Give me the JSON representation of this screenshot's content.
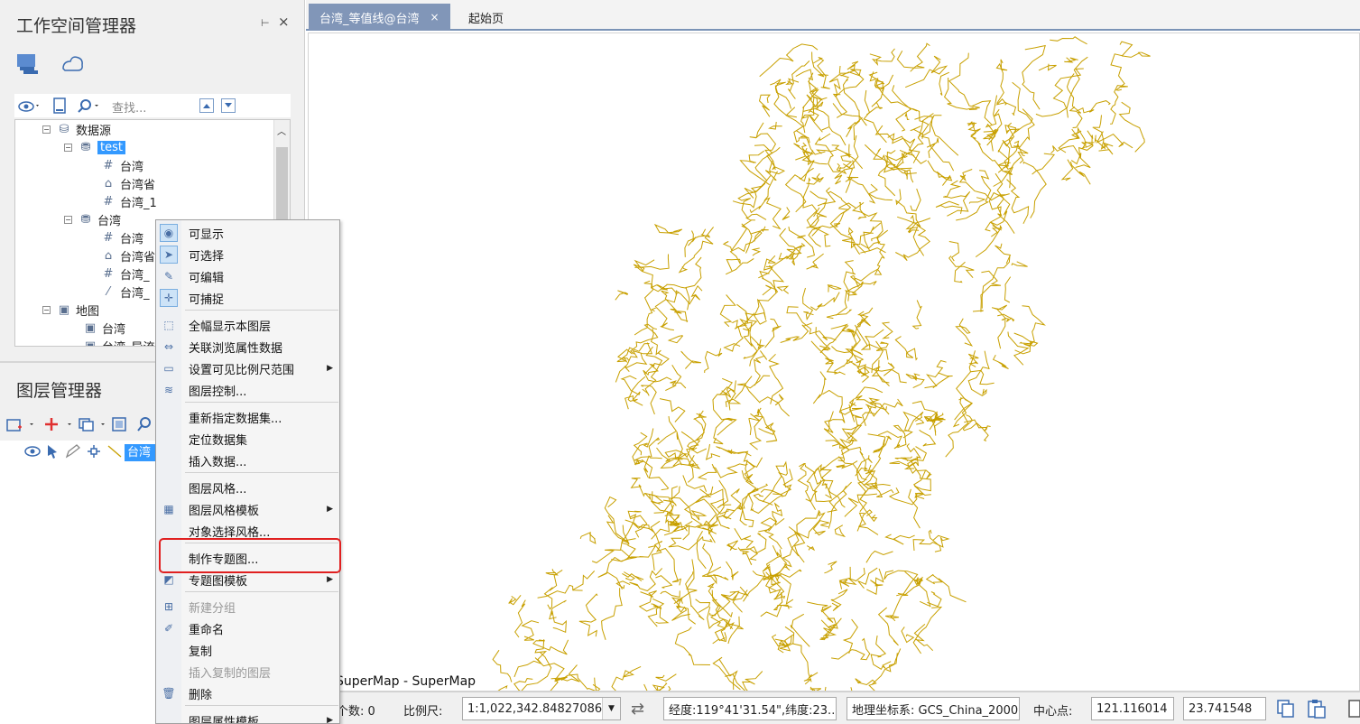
{
  "workspace": {
    "title": "工作空间管理器",
    "pin": "⊢",
    "close": "×",
    "search_placeholder": "查找...",
    "tree": [
      {
        "label": "数据源",
        "depth": 0
      },
      {
        "label": "test",
        "depth": 1,
        "selected": true
      },
      {
        "label": "台湾",
        "depth": 2
      },
      {
        "label": "台湾省",
        "depth": 2
      },
      {
        "label": "台湾_1",
        "depth": 2
      },
      {
        "label": "台湾",
        "depth": 1
      },
      {
        "label": "台湾",
        "depth": 2
      },
      {
        "label": "台湾省",
        "depth": 2
      },
      {
        "label": "台湾_",
        "depth": 2
      },
      {
        "label": "台湾_",
        "depth": 2
      },
      {
        "label": "地图",
        "depth": 0
      },
      {
        "label": "台湾",
        "depth": 1
      },
      {
        "label": "台湾_导流",
        "depth": 1
      }
    ]
  },
  "layers": {
    "title": "图层管理器",
    "layer_label": "台湾_"
  },
  "tabs": [
    {
      "label": "台湾_等值线@台湾",
      "close": "×"
    },
    {
      "label": "起始页"
    }
  ],
  "map": {
    "app_label": "SuperMap - SuperMap",
    "contour_color": "#c8a000"
  },
  "status": {
    "count_label": "个数: 0",
    "scale_label": "比例尺:",
    "scale_value": "1:1,022,342.84827086",
    "coords": "经度:119°41'31.54\",纬度:23...",
    "crs": "地理坐标系: GCS_China_2000",
    "center_label": "中心点:",
    "center_x": "121.116014",
    "center_y": "23.741548"
  },
  "context_menu": [
    {
      "label": "可显示",
      "checked": true,
      "icon": "eye-icon"
    },
    {
      "label": "可选择",
      "checked": true,
      "icon": "cursor-icon"
    },
    {
      "label": "可编辑",
      "icon": "pencil-icon"
    },
    {
      "label": "可捕捉",
      "checked": true,
      "icon": "snap-icon"
    },
    {
      "sep": true
    },
    {
      "label": "全幅显示本图层",
      "icon": "full-extent-icon"
    },
    {
      "label": "关联浏览属性数据",
      "icon": "link-icon"
    },
    {
      "label": "设置可见比例尺范围",
      "submenu": true,
      "icon": "scale-icon"
    },
    {
      "label": "图层控制...",
      "icon": "layers-icon"
    },
    {
      "sep": true
    },
    {
      "label": "重新指定数据集..."
    },
    {
      "label": "定位数据集"
    },
    {
      "label": "插入数据..."
    },
    {
      "sep": true
    },
    {
      "label": "图层风格..."
    },
    {
      "label": "图层风格模板",
      "submenu": true,
      "icon": "style-icon"
    },
    {
      "label": "对象选择风格..."
    },
    {
      "sep": true
    },
    {
      "label": "制作专题图..."
    },
    {
      "label": "专题图模板",
      "submenu": true,
      "icon": "thematic-icon"
    },
    {
      "sep": true
    },
    {
      "label": "新建分组",
      "disabled": true,
      "icon": "group-icon"
    },
    {
      "label": "重命名",
      "icon": "rename-icon"
    },
    {
      "label": "复制"
    },
    {
      "label": "插入复制的图层",
      "disabled": true
    },
    {
      "label": "删除",
      "icon": "trash-icon"
    },
    {
      "sep": true
    },
    {
      "label": "图层属性模板",
      "submenu": true
    }
  ]
}
